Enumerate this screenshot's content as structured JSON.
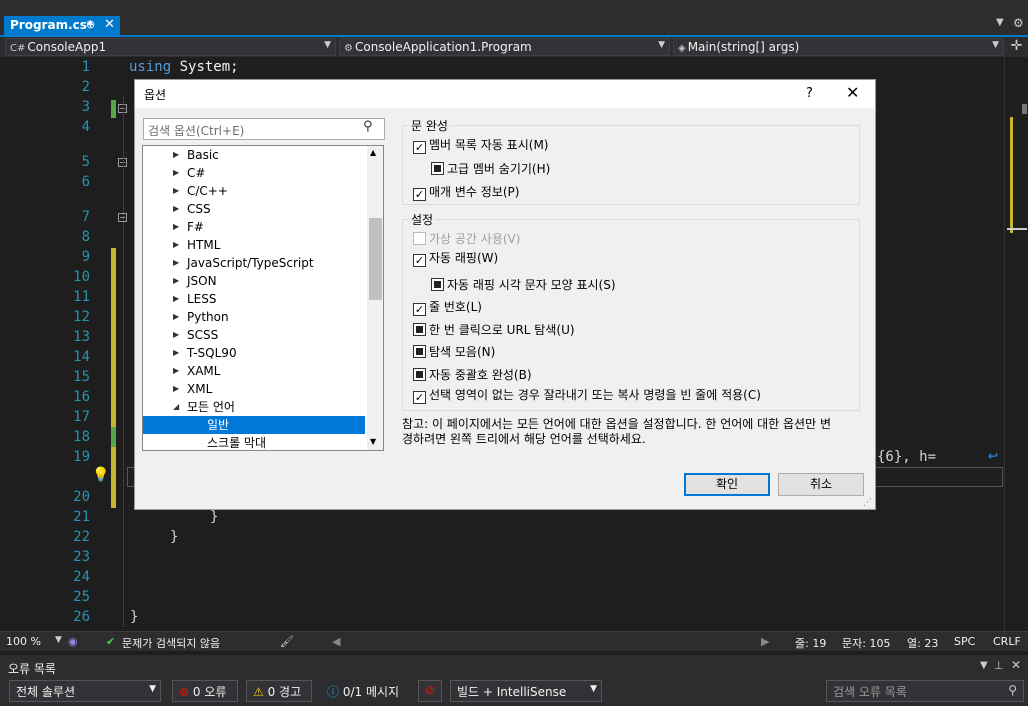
{
  "tab": {
    "title": "Program.cs*",
    "pin": "⊕",
    "close": "✕"
  },
  "navbar": {
    "project": "ConsoleApp1",
    "class": "ConsoleApplication1.Program",
    "member": "Main(string[] args)"
  },
  "editor": {
    "line_numbers": [
      "1",
      "2",
      "3",
      "4",
      "5",
      "6",
      "7",
      "8",
      "9",
      "10",
      "11",
      "12",
      "13",
      "14",
      "15",
      "16",
      "17",
      "18",
      "19",
      "20",
      "21",
      "22",
      "23",
      "24",
      "25",
      "26"
    ],
    "line1_kw": "using",
    "line1_rest": " System;",
    "line19_frag": "{6}, h=",
    "brace_inner": "}",
    "brace_outer": "}",
    "brace_last": "}"
  },
  "dialog": {
    "title": "옵션",
    "help": "?",
    "close": "✕",
    "search_placeholder": "검색 옵션(Ctrl+E)",
    "tree": [
      "Basic",
      "C#",
      "C/C++",
      "CSS",
      "F#",
      "HTML",
      "JavaScript/TypeScript",
      "JSON",
      "LESS",
      "Python",
      "SCSS",
      "T-SQL90",
      "XAML",
      "XML",
      "모든 언어",
      "일반",
      "스크롤 막대"
    ],
    "group1": {
      "label": "문 완성",
      "member_list": "멤버 목록 자동 표시(M)",
      "hide_advanced": "고급 멤버 숨기기(H)",
      "param_info": "매개 변수 정보(P)"
    },
    "group2": {
      "label": "설정",
      "virtual_space": "가상 공간 사용(V)",
      "word_wrap": "자동 래핑(W)",
      "wrap_glyphs": "자동 래핑 시각 문자 모양 표시(S)",
      "line_numbers": "줄 번호(L)",
      "single_click_url": "한 번 클릭으로 URL 탐색(U)",
      "nav_bar": "탐색 모음(N)",
      "brace_completion": "자동 중괄호 완성(B)",
      "cut_copy_blank": "선택 영역이 없는 경우 잘라내기 또는 복사 명령을 빈 줄에 적용(C)"
    },
    "note": "참고: 이 페이지에서는 모든 언어에 대한 옵션을 설정합니다. 한 언어에 대한 옵션만 변경하려면 왼쪽 트리에서 해당 언어를 선택하세요.",
    "ok": "확인",
    "cancel": "취소"
  },
  "status": {
    "zoom": "100 %",
    "issues": "문제가 검색되지 않음",
    "line": "줄: 19",
    "char": "문자: 105",
    "col": "열: 23",
    "spc": "SPC",
    "crlf": "CRLF"
  },
  "error_list": {
    "title": "오류 목록",
    "scope": "전체 솔루션",
    "errors": "0 오류",
    "warnings": "0 경고",
    "messages": "0/1 메시지",
    "build": "빌드 + IntelliSense",
    "search": "검색 오류 목록"
  },
  "colors": {
    "accent": "#007acc",
    "keyword": "#569cd6",
    "line_number": "#2b91af"
  }
}
